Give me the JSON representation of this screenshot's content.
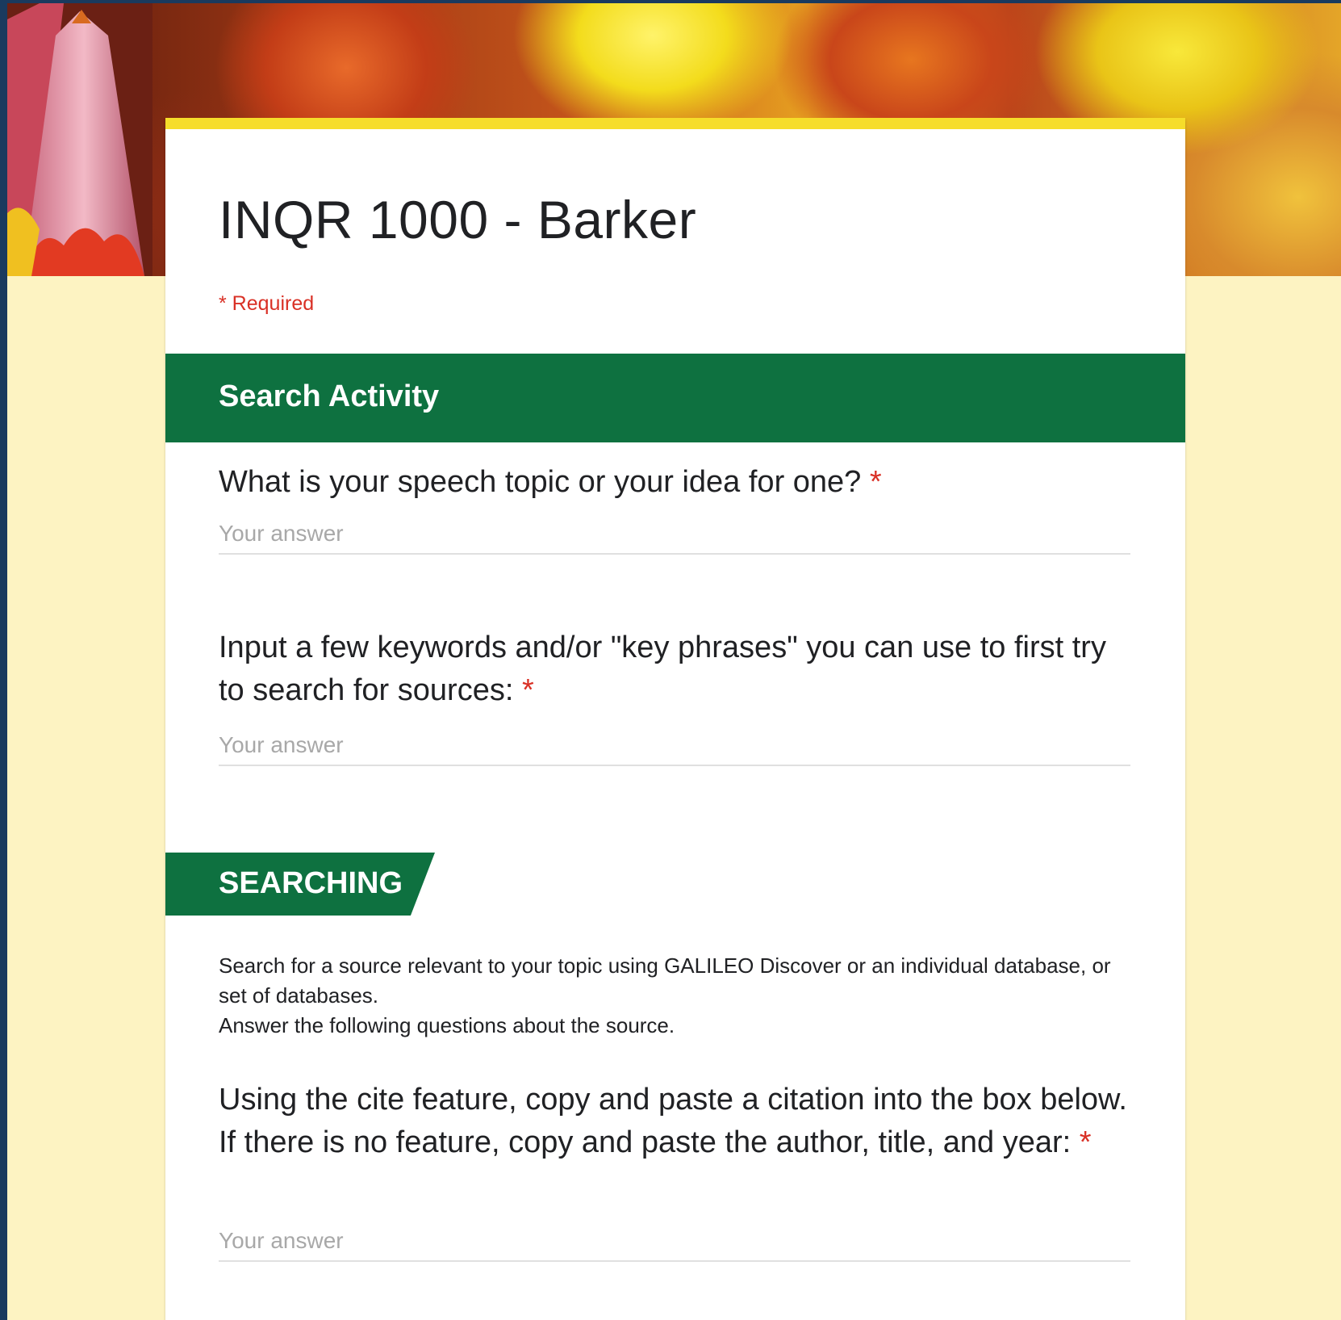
{
  "form": {
    "title": "INQR 1000 - Barker",
    "required_note": "* Required"
  },
  "sections": [
    {
      "title": "Search Activity",
      "questions": [
        {
          "text": "What is your speech topic or your idea for one?",
          "required_mark": "*",
          "placeholder": "Your answer"
        },
        {
          "text": "Input a few keywords and/or \"key phrases\" you can use to first try to search for sources:",
          "required_mark": "*",
          "placeholder": "Your answer"
        }
      ]
    },
    {
      "title": "SEARCHING",
      "description_line1": "Search for a source relevant to your topic using GALILEO Discover or an individual database, or set of databases.",
      "description_line2": "Answer the following questions about the source.",
      "questions": [
        {
          "text": "Using the cite feature, copy and paste a citation into the box below. If there is no feature, copy and paste the author, title, and year:",
          "required_mark": "*",
          "placeholder": "Your answer"
        }
      ]
    }
  ],
  "colors": {
    "accent_green": "#0e7140",
    "accent_yellow": "#f6dd2a",
    "page_background": "#fdf3c2",
    "required_red": "#d93025"
  },
  "header_image": "colored-pencils-banner"
}
